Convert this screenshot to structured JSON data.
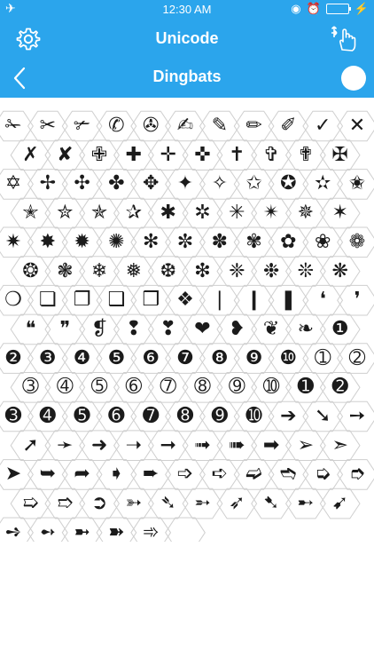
{
  "status_bar": {
    "time": "12:30 AM"
  },
  "header": {
    "title": "Unicode"
  },
  "subheader": {
    "title": "Dingbats"
  },
  "icons": {
    "settings": "gear-icon",
    "touch": "touch-hand-icon",
    "back": "chevron-left-icon",
    "toggle": "toggle-circle"
  },
  "colors": {
    "accent": "#2ba5ec",
    "grid_line": "#cfcfcf",
    "glyph": "#1b1b1b"
  },
  "dingbats": [
    [
      "✁",
      "✂",
      "✃",
      "✆",
      "✇",
      "✍",
      "✎",
      "✏",
      "✐",
      "✓",
      "✕"
    ],
    [
      "✗",
      "✘",
      "✙",
      "✚",
      "✛",
      "✜",
      "✝",
      "✞",
      "✟",
      "✠"
    ],
    [
      "✡",
      "✢",
      "✣",
      "✤",
      "✥",
      "✦",
      "✧",
      "✩",
      "✪",
      "✫",
      "✬"
    ],
    [
      "✭",
      "✮",
      "✯",
      "✰",
      "✱",
      "✲",
      "✳",
      "✴",
      "✵",
      "✶"
    ],
    [
      "✷",
      "✸",
      "✹",
      "✺",
      "✻",
      "✼",
      "✽",
      "✾",
      "✿",
      "❀",
      "❁"
    ],
    [
      "❂",
      "❃",
      "❄",
      "❅",
      "❆",
      "❇",
      "❈",
      "❉",
      "❊",
      "❋"
    ],
    [
      "❍",
      "❏",
      "❐",
      "❑",
      "❒",
      "❖",
      "❘",
      "❙",
      "❚",
      "❛",
      "❜"
    ],
    [
      "❝",
      "❞",
      "❡",
      "❢",
      "❣",
      "❤",
      "❥",
      "❦",
      "❧",
      "❶"
    ],
    [
      "❷",
      "❸",
      "❹",
      "❺",
      "❻",
      "❼",
      "❽",
      "❾",
      "❿",
      "➀",
      "➁"
    ],
    [
      "➂",
      "➃",
      "➄",
      "➅",
      "➆",
      "➇",
      "➈",
      "➉",
      "➊",
      "➋"
    ],
    [
      "➌",
      "➍",
      "➎",
      "➏",
      "➐",
      "➑",
      "➒",
      "➓",
      "➔",
      "➘",
      "➙"
    ],
    [
      "➚",
      "➛",
      "➜",
      "➝",
      "➞",
      "➟",
      "➠",
      "➡",
      "➢",
      "➣"
    ],
    [
      "➤",
      "➥",
      "➦",
      "➧",
      "➨",
      "➩",
      "➪",
      "➫",
      "➬",
      "➭",
      "➮"
    ],
    [
      "➯",
      "➱",
      "➲",
      "➳",
      "➴",
      "➵",
      "➶",
      "➷",
      "➸",
      "➹"
    ],
    [
      "➺",
      "➻",
      "➼",
      "➽",
      "➾",
      ""
    ]
  ]
}
